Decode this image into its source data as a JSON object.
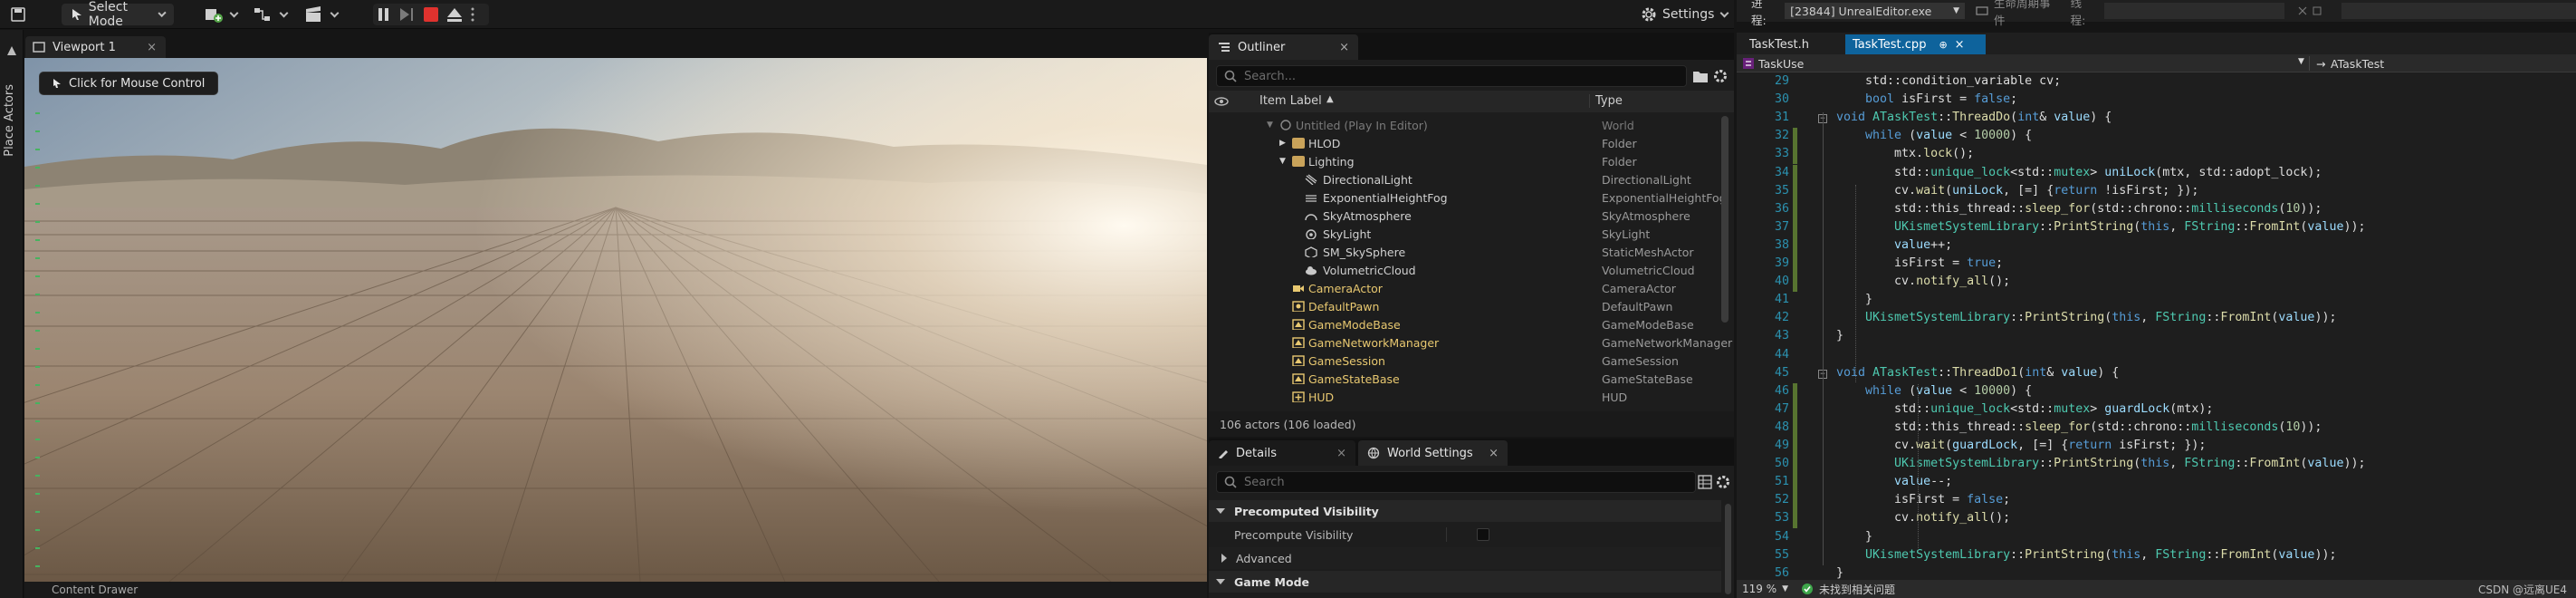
{
  "ue_toolbar": {
    "select_mode": "Select Mode",
    "settings": "Settings"
  },
  "left_strip": {
    "place_actors": "Place Actors"
  },
  "viewport": {
    "tab_label": "Viewport 1",
    "mouse_control": "Click for Mouse Control",
    "bottom_label": "Content Drawer"
  },
  "outliner": {
    "tab_label": "Outliner",
    "search_placeholder": "Search...",
    "col_item_label": "Item Label",
    "col_type": "Type",
    "rows": [
      {
        "label": "Untitled (Play In Editor)",
        "type": "World"
      },
      {
        "label": "HLOD",
        "type": "Folder"
      },
      {
        "label": "Lighting",
        "type": "Folder"
      },
      {
        "label": "DirectionalLight",
        "type": "DirectionalLight"
      },
      {
        "label": "ExponentialHeightFog",
        "type": "ExponentialHeightFog"
      },
      {
        "label": "SkyAtmosphere",
        "type": "SkyAtmosphere"
      },
      {
        "label": "SkyLight",
        "type": "SkyLight"
      },
      {
        "label": "SM_SkySphere",
        "type": "StaticMeshActor"
      },
      {
        "label": "VolumetricCloud",
        "type": "VolumetricCloud"
      },
      {
        "label": "CameraActor",
        "type": "CameraActor"
      },
      {
        "label": "DefaultPawn",
        "type": "DefaultPawn"
      },
      {
        "label": "GameModeBase",
        "type": "GameModeBase"
      },
      {
        "label": "GameNetworkManager",
        "type": "GameNetworkManager"
      },
      {
        "label": "GameSession",
        "type": "GameSession"
      },
      {
        "label": "GameStateBase",
        "type": "GameStateBase"
      },
      {
        "label": "HUD",
        "type": "HUD"
      }
    ],
    "footer": "106 actors (106 loaded)"
  },
  "details": {
    "tab_details": "Details",
    "tab_world_settings": "World Settings",
    "search_placeholder": "Search",
    "sections": [
      {
        "label": "Precomputed Visibility"
      },
      {
        "label": "Precompute Visibility"
      },
      {
        "label": "Advanced"
      },
      {
        "label": "Game Mode"
      }
    ]
  },
  "vs": {
    "process_label": "进程:",
    "process_value": "[23844] UnrealEditor.exe",
    "lifecycle_label": "生命周期事件",
    "thread_label": "线程:",
    "tabs": [
      {
        "label": "TaskTest.h"
      },
      {
        "label": "TaskTest.cpp"
      }
    ],
    "nav_left": "TaskUse",
    "nav_right": "ATaskTest",
    "zoom": "119 %",
    "issues": "未找到相关问题",
    "watermark": "CSDN @远离UE4",
    "lines": [
      {
        "num": "29",
        "html": "    std::condition_variable cv;"
      },
      {
        "num": "30",
        "html": "    <span class=\"kw\">bool</span> isFirst = <span class=\"kw\">false</span>;"
      },
      {
        "num": "31",
        "html": "<span class=\"kw\">void</span> <span class=\"ty\">ATaskTest</span>::<span class=\"fn\">ThreadDo</span>(<span class=\"kw\">int</span>&amp; <span class=\"vr\">value</span>) {"
      },
      {
        "num": "32",
        "html": "    <span class=\"kw\">while</span> (<span class=\"vr\">value</span> &lt; <span class=\"nm\">10000</span>) {"
      },
      {
        "num": "33",
        "html": "        mtx.<span class=\"fn\">lock</span>();"
      },
      {
        "num": "34",
        "html": "        std::<span class=\"ty\">unique_lock</span>&lt;std::<span class=\"ty\">mutex</span>&gt; <span class=\"vr\">uniLock</span>(mtx, std::adopt_lock);"
      },
      {
        "num": "35",
        "html": "        cv.<span class=\"fn\">wait</span>(<span class=\"vr\">uniLock</span>, [=] {<span class=\"kw\">return</span> !isFirst; });"
      },
      {
        "num": "36",
        "html": "        std::this_thread::<span class=\"fn\">sleep_for</span>(std::chrono::<span class=\"ty\">milliseconds</span>(<span class=\"nm\">10</span>));"
      },
      {
        "num": "37",
        "html": "        <span class=\"ty\">UKismetSystemLibrary</span>::<span class=\"fn\">PrintString</span>(<span class=\"kw\">this</span>, <span class=\"ty\">FString</span>::<span class=\"fn\">FromInt</span>(<span class=\"vr\">value</span>));"
      },
      {
        "num": "38",
        "html": "        <span class=\"vr\">value</span>++;"
      },
      {
        "num": "39",
        "html": "        isFirst = <span class=\"kw\">true</span>;"
      },
      {
        "num": "40",
        "html": "        cv.<span class=\"fn\">notify_all</span>();"
      },
      {
        "num": "41",
        "html": "    }"
      },
      {
        "num": "42",
        "html": "    <span class=\"ty\">UKismetSystemLibrary</span>::<span class=\"fn\">PrintString</span>(<span class=\"kw\">this</span>, <span class=\"ty\">FString</span>::<span class=\"fn\">FromInt</span>(<span class=\"vr\">value</span>));"
      },
      {
        "num": "43",
        "html": "}"
      },
      {
        "num": "44",
        "html": ""
      },
      {
        "num": "45",
        "html": "<span class=\"kw\">void</span> <span class=\"ty\">ATaskTest</span>::<span class=\"fn\">ThreadDo1</span>(<span class=\"kw\">int</span>&amp; <span class=\"vr\">value</span>) {"
      },
      {
        "num": "46",
        "html": "    <span class=\"kw\">while</span> (<span class=\"vr\">value</span> &lt; <span class=\"nm\">10000</span>) {"
      },
      {
        "num": "47",
        "html": "        std::<span class=\"ty\">unique_lock</span>&lt;std::<span class=\"ty\">mutex</span>&gt; <span class=\"vr\">guardLock</span>(mtx);"
      },
      {
        "num": "48",
        "html": "        std::this_thread::<span class=\"fn\">sleep_for</span>(std::chrono::<span class=\"ty\">milliseconds</span>(<span class=\"nm\">10</span>));"
      },
      {
        "num": "49",
        "html": "        cv.<span class=\"fn\">wait</span>(<span class=\"vr\">guardLock</span>, [=] {<span class=\"kw\">return</span> isFirst; });"
      },
      {
        "num": "50",
        "html": "        <span class=\"ty\">UKismetSystemLibrary</span>::<span class=\"fn\">PrintString</span>(<span class=\"kw\">this</span>, <span class=\"ty\">FString</span>::<span class=\"fn\">FromInt</span>(<span class=\"vr\">value</span>));"
      },
      {
        "num": "51",
        "html": "        <span class=\"vr\">value</span>--;"
      },
      {
        "num": "52",
        "html": "        isFirst = <span class=\"kw\">false</span>;"
      },
      {
        "num": "53",
        "html": "        cv.<span class=\"fn\">notify_all</span>();"
      },
      {
        "num": "54",
        "html": "    }"
      },
      {
        "num": "55",
        "html": "    <span class=\"ty\">UKismetSystemLibrary</span>::<span class=\"fn\">PrintString</span>(<span class=\"kw\">this</span>, <span class=\"ty\">FString</span>::<span class=\"fn\">FromInt</span>(<span class=\"vr\">value</span>));"
      },
      {
        "num": "56",
        "html": "}"
      }
    ]
  }
}
